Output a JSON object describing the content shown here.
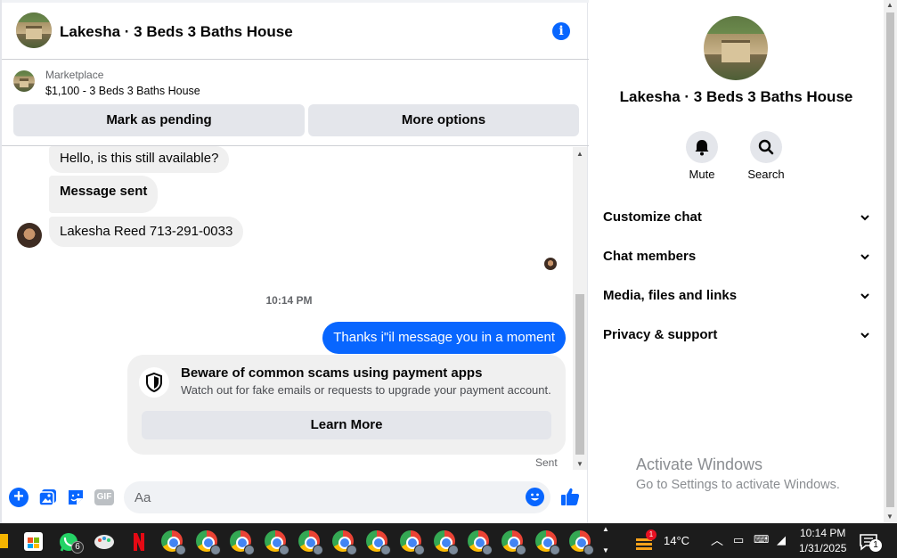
{
  "header": {
    "title": "Lakesha · 3 Beds 3 Baths House"
  },
  "marketplace": {
    "label": "Marketplace",
    "listing": "$1,100 - 3 Beds 3 Baths House",
    "mark_pending": "Mark as pending",
    "more_options": "More options"
  },
  "messages": {
    "incoming": [
      "Hello, is this still available?",
      "Message sent",
      "Lakesha Reed 713-291-0033"
    ],
    "timestamp": "10:14 PM",
    "outgoing": "Thanks i\"il message you in a moment",
    "scam_title": "Beware of common scams using payment apps",
    "scam_sub": "Watch out for fake emails or requests to upgrade your payment account.",
    "learn_more": "Learn More",
    "sent": "Sent"
  },
  "composer": {
    "placeholder": "Aa",
    "gif": "GIF"
  },
  "sidebar": {
    "title": "Lakesha · 3 Beds 3 Baths House",
    "mute": "Mute",
    "search": "Search",
    "menu": [
      "Customize chat",
      "Chat members",
      "Media, files and links",
      "Privacy & support"
    ]
  },
  "watermark": {
    "title": "Activate Windows",
    "sub": "Go to Settings to activate Windows."
  },
  "taskbar": {
    "whatsapp_badge": "6",
    "weather_badge": "1",
    "temperature": "14°C",
    "time": "10:14 PM",
    "date": "1/31/2025",
    "notification_count": "1"
  },
  "colors": {
    "accent": "#0866ff",
    "bubble_in": "#f0f0f0",
    "taskbar": "#1c1c1c"
  }
}
